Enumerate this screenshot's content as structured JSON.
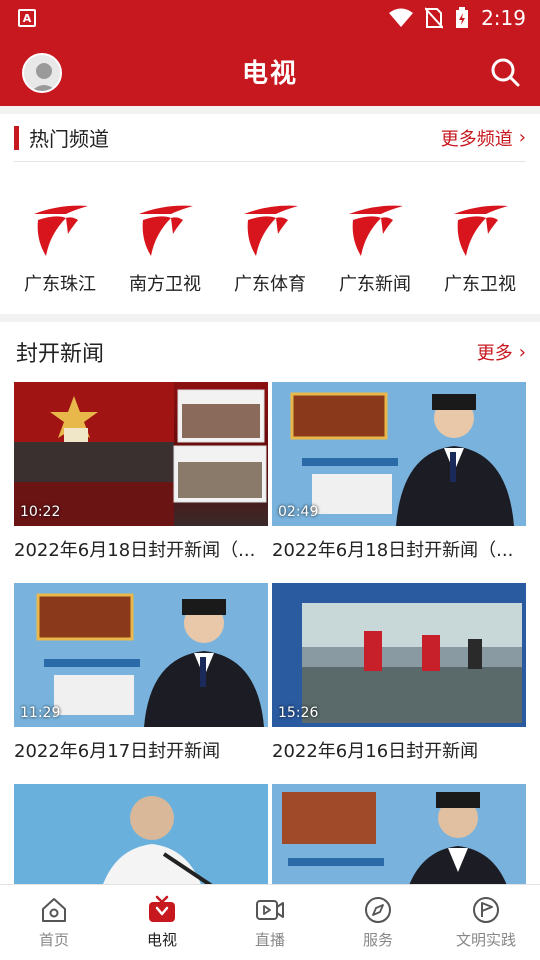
{
  "status_bar": {
    "app_badge": "A",
    "time": "2:19"
  },
  "header": {
    "title": "电视"
  },
  "hot_channels": {
    "title": "热门频道",
    "more_label": "更多频道",
    "chevron": "›",
    "items": [
      {
        "label": "广东珠江"
      },
      {
        "label": "南方卫视"
      },
      {
        "label": "广东体育"
      },
      {
        "label": "广东新闻"
      },
      {
        "label": "广东卫视"
      }
    ]
  },
  "news": {
    "title": "封开新闻",
    "more_label": "更多",
    "chevron": "›",
    "items": [
      {
        "title": "2022年6月18日封开新闻（...",
        "duration": "10:22"
      },
      {
        "title": "2022年6月18日封开新闻（...",
        "duration": "02:49"
      },
      {
        "title": "2022年6月17日封开新闻",
        "duration": "11:29"
      },
      {
        "title": "2022年6月16日封开新闻",
        "duration": "15:26"
      },
      {
        "title": "",
        "duration": ""
      },
      {
        "title": "",
        "duration": ""
      }
    ]
  },
  "tabbar": {
    "items": [
      {
        "label": "首页",
        "icon": "home-icon"
      },
      {
        "label": "电视",
        "icon": "tv-icon"
      },
      {
        "label": "直播",
        "icon": "live-icon"
      },
      {
        "label": "服务",
        "icon": "compass-icon"
      },
      {
        "label": "文明实践",
        "icon": "flag-icon"
      }
    ]
  },
  "colors": {
    "brand_red": "#c8181f"
  }
}
